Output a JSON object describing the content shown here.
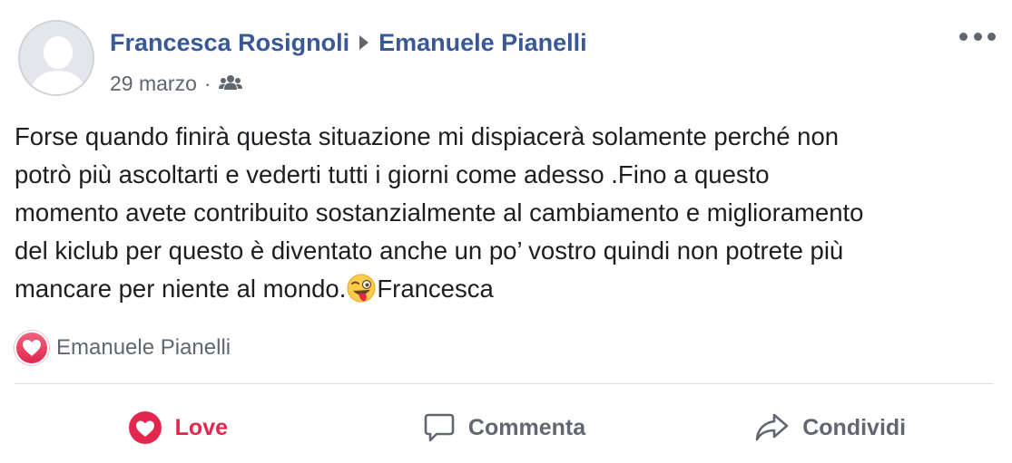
{
  "post": {
    "author": "Francesca Rosignoli",
    "recipient": "Emanuele Pianelli",
    "date": "29 marzo",
    "separator": "·",
    "audience_icon": "friends-icon",
    "more_icon": "more-options-icon",
    "text_lines": [
      "Forse quando finirà questa situazione mi dispiacerà solamente perché non",
      "potrò più ascoltarti e vederti tutti i giorni come adesso .Fino a questo",
      "momento avete contribuito sostanzialmente al cambiamento e miglioramento",
      "del kiclub per questo è diventato anche un po’ vostro quindi non potrete più",
      "mancare per niente al mondo."
    ],
    "text_tail": "Francesca",
    "emoji": "winking-face-with-tongue"
  },
  "reactions": {
    "type": "love",
    "names": "Emanuele Pianelli"
  },
  "actions": {
    "love": "Love",
    "comment": "Commenta",
    "share": "Condividi"
  },
  "colors": {
    "link": "#385898",
    "love": "#e2264d",
    "muted": "#616770",
    "divider": "#dadde1"
  }
}
